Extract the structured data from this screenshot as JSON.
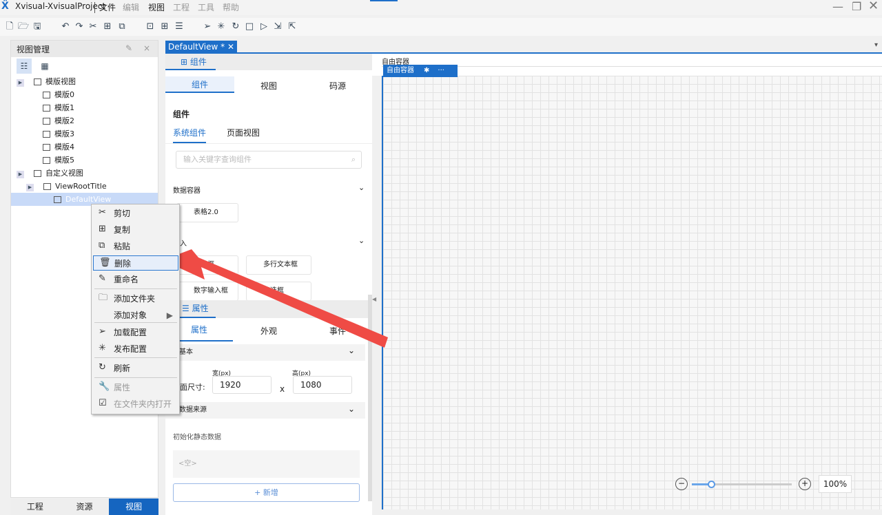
{
  "app": {
    "title": "Xvisual-XvisualProject",
    "menus": [
      {
        "label": "文件",
        "enabled": true
      },
      {
        "label": "编辑",
        "enabled": false
      },
      {
        "label": "视图",
        "enabled": true
      },
      {
        "label": "工程",
        "enabled": false
      },
      {
        "label": "工具",
        "enabled": false
      },
      {
        "label": "帮助",
        "enabled": false
      }
    ]
  },
  "left": {
    "title": "视图管理",
    "tree": [
      {
        "label": "模版视图",
        "level": 0,
        "expand": true
      },
      {
        "label": "模版0",
        "level": 1
      },
      {
        "label": "模版1",
        "level": 1
      },
      {
        "label": "模版2",
        "level": 1
      },
      {
        "label": "模版3",
        "level": 1
      },
      {
        "label": "模版4",
        "level": 1
      },
      {
        "label": "模版5",
        "level": 1
      },
      {
        "label": "自定义视图",
        "level": 0,
        "expand": true
      },
      {
        "label": "ViewRootTitle",
        "level": 1,
        "expand": true
      },
      {
        "label": "DefaultView",
        "level": 2,
        "selected": true
      }
    ],
    "bottom_tabs": [
      "工程",
      "资源",
      "视图"
    ]
  },
  "doc": {
    "tab": "DefaultView *"
  },
  "components": {
    "panel_tab": "组件",
    "tabs": [
      "组件",
      "视图",
      "码源"
    ],
    "heading": "组件",
    "subtabs": [
      "系统组件",
      "页面视图"
    ],
    "search_placeholder": "输入关键字查询组件",
    "groups": [
      {
        "label": "数据容器",
        "items": [
          "表格2.0"
        ]
      },
      {
        "label": "输入",
        "items": [
          "输入框",
          "多行文本框",
          "数字输入框",
          "复选框"
        ]
      }
    ]
  },
  "props": {
    "panel_tab": "属性",
    "tabs": [
      "属性",
      "外观",
      "事件"
    ],
    "section_basic": "基本",
    "size_label": "页面尺寸:",
    "width_label": "宽(px)",
    "height_label": "高(px)",
    "width": "1920",
    "height": "1080",
    "x": "x",
    "section_data": "数据来源",
    "init_label": "初始化静态数据",
    "empty": "<空>",
    "add": "+ 新增"
  },
  "canvas": {
    "label": "自由容器",
    "tag": "自由容器",
    "zoom": "100%",
    "zoom_fraction": 0.2
  },
  "context_menu": [
    {
      "label": "剪切",
      "icon": "scissors-icon"
    },
    {
      "label": "复制",
      "icon": "copy-icon"
    },
    {
      "label": "粘贴",
      "icon": "paste-icon"
    },
    {
      "label": "删除",
      "icon": "trash-icon",
      "hl": true
    },
    {
      "label": "重命名",
      "icon": "pen-icon"
    },
    {
      "label": "添加文件夹",
      "icon": "folder-icon"
    },
    {
      "label": "添加对象",
      "icon": "",
      "sub": true
    },
    {
      "label": "加载配置",
      "icon": "send-icon"
    },
    {
      "label": "发布配置",
      "icon": "publish-icon"
    },
    {
      "label": "刷新",
      "icon": "refresh-icon"
    },
    {
      "label": "属性",
      "icon": "wrench-icon",
      "dis": true
    },
    {
      "label": "在文件夹内打开",
      "icon": "open-folder-icon",
      "dis": true
    }
  ],
  "colors": {
    "accent": "#1e6fc9",
    "arrow": "#ef4b45"
  }
}
